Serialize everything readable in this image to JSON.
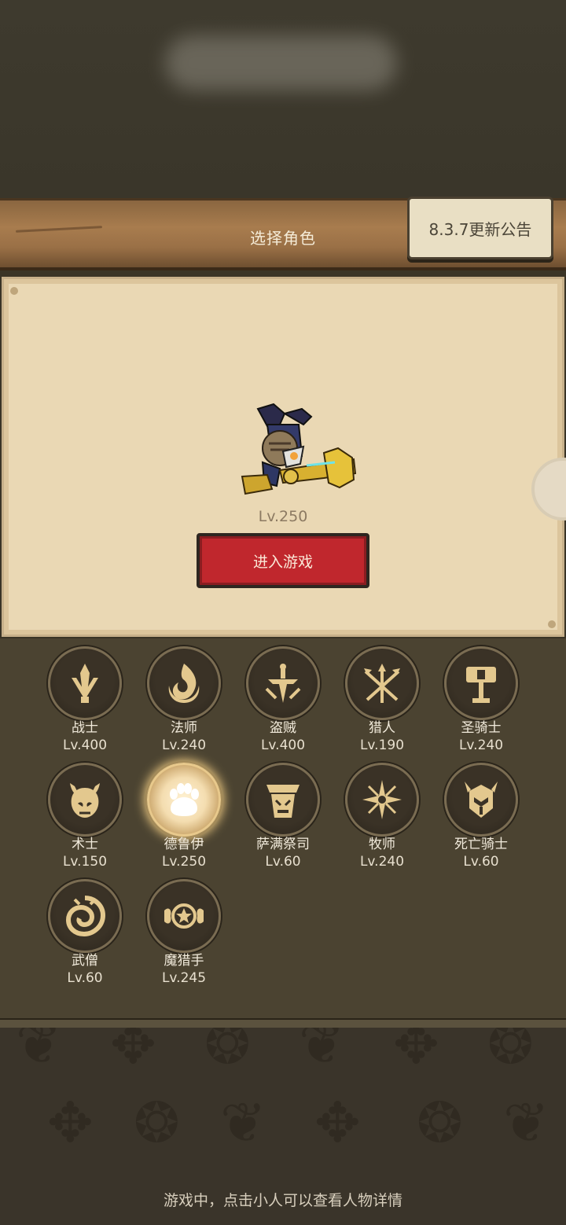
{
  "header": {
    "title": "选择角色",
    "notice_button": "8.3.7更新公告"
  },
  "preview": {
    "level": "Lv.250",
    "enter_button": "进入游戏"
  },
  "classes": [
    {
      "name": "战士",
      "level": "Lv.400",
      "icon": "sword-icon",
      "selected": false
    },
    {
      "name": "法师",
      "level": "Lv.240",
      "icon": "flame-icon",
      "selected": false
    },
    {
      "name": "盗贼",
      "level": "Lv.400",
      "icon": "dagger-icon",
      "selected": false
    },
    {
      "name": "猎人",
      "level": "Lv.190",
      "icon": "crossed-arrows-icon",
      "selected": false
    },
    {
      "name": "圣骑士",
      "level": "Lv.240",
      "icon": "hammer-icon",
      "selected": false
    },
    {
      "name": "术士",
      "level": "Lv.150",
      "icon": "demon-skull-icon",
      "selected": false
    },
    {
      "name": "德鲁伊",
      "level": "Lv.250",
      "icon": "paw-icon",
      "selected": true
    },
    {
      "name": "萨满祭司",
      "level": "Lv.60",
      "icon": "totem-icon",
      "selected": false
    },
    {
      "name": "牧师",
      "level": "Lv.240",
      "icon": "holy-star-icon",
      "selected": false
    },
    {
      "name": "死亡骑士",
      "level": "Lv.60",
      "icon": "helmet-icon",
      "selected": false
    },
    {
      "name": "武僧",
      "level": "Lv.60",
      "icon": "swirl-icon",
      "selected": false
    },
    {
      "name": "魔猎手",
      "level": "Lv.245",
      "icon": "demon-star-icon",
      "selected": false
    }
  ],
  "footer": {
    "hint": "游戏中，点击小人可以查看人物详情"
  },
  "colors": {
    "enter_button": "#c0272d",
    "icon_gold": "#e3c88e",
    "panel": "#ead8b4"
  }
}
